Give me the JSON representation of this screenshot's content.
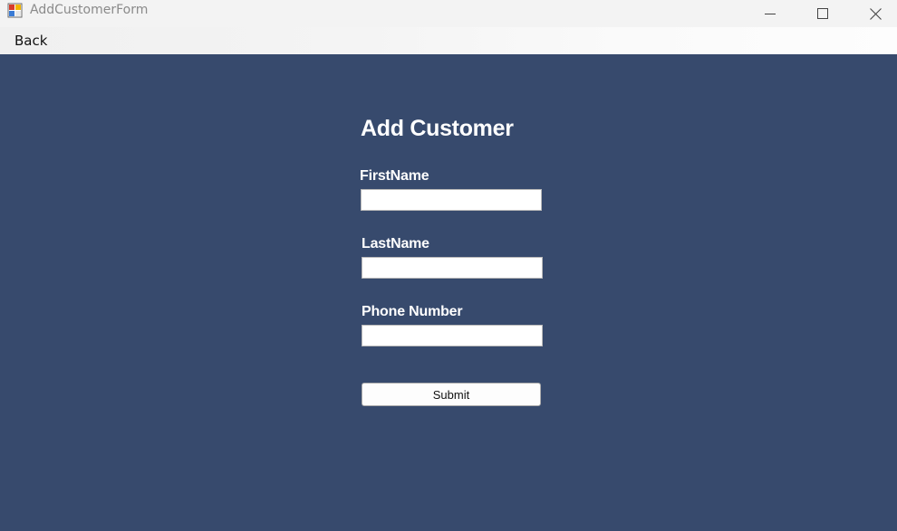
{
  "window": {
    "title": "AddCustomerForm",
    "icon": "winforms-app-icon",
    "controls": {
      "minimize": "minimize-icon",
      "maximize": "maximize-icon",
      "close": "close-icon"
    }
  },
  "menu": {
    "items": [
      {
        "label": "Back"
      }
    ]
  },
  "form": {
    "title": "Add Customer",
    "fields": [
      {
        "label": "FirstName",
        "value": "",
        "placeholder": ""
      },
      {
        "label": "LastName",
        "value": "",
        "placeholder": ""
      },
      {
        "label": "Phone Number",
        "value": "",
        "placeholder": ""
      }
    ],
    "submit_label": "Submit"
  },
  "colors": {
    "background": "#374a6d",
    "titlebar": "#f3f3f3",
    "label_text": "#ffffff"
  }
}
